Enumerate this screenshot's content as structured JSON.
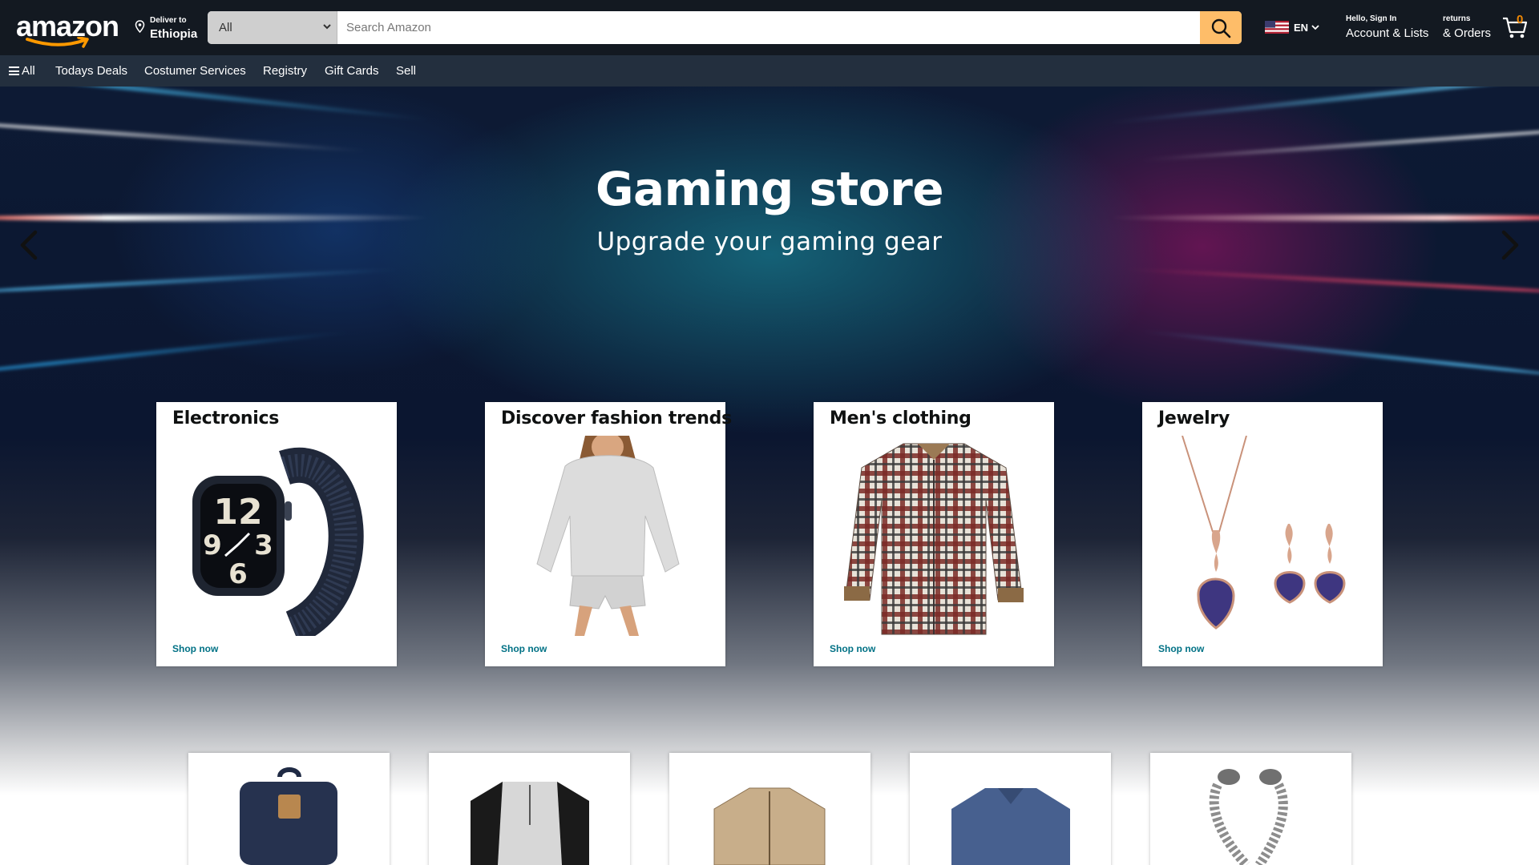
{
  "header": {
    "logo_text": "amazon",
    "deliver": {
      "label": "Deliver to",
      "location": "Ethiopia"
    },
    "search": {
      "category": "All",
      "placeholder": "Search Amazon"
    },
    "language": {
      "code": "EN",
      "flag_icon": "us-flag-icon"
    },
    "account": {
      "greeting": "Hello, Sign In",
      "label": "Account & Lists"
    },
    "orders": {
      "small": "returns",
      "label": "& Orders"
    },
    "cart": {
      "count": "0"
    }
  },
  "subnav": {
    "all_label": "All",
    "items": [
      "Todays Deals",
      "Costumer Services",
      "Registry",
      "Gift Cards",
      "Sell"
    ]
  },
  "hero": {
    "title": "Gaming store",
    "subtitle": "Upgrade your gaming gear"
  },
  "cards": [
    {
      "title": "Electronics",
      "link": "Shop now",
      "image": "smartwatch-image"
    },
    {
      "title": "Discover fashion trends",
      "link": "Shop now",
      "image": "loungewear-model-image"
    },
    {
      "title": "Men's clothing",
      "link": "Shop now",
      "image": "plaid-shirt-image"
    },
    {
      "title": "Jewelry",
      "link": "Shop now",
      "image": "necklace-earrings-image"
    }
  ],
  "products": [
    {
      "image": "backpack-image"
    },
    {
      "image": "henley-shirt-image"
    },
    {
      "image": "jacket-image"
    },
    {
      "image": "blue-sweater-image"
    },
    {
      "image": "bracelet-image"
    }
  ],
  "colors": {
    "topbar": "#131921",
    "subnav": "#232f3e",
    "search_button": "#febd69",
    "link": "#007185",
    "cart_count": "#f08804"
  }
}
